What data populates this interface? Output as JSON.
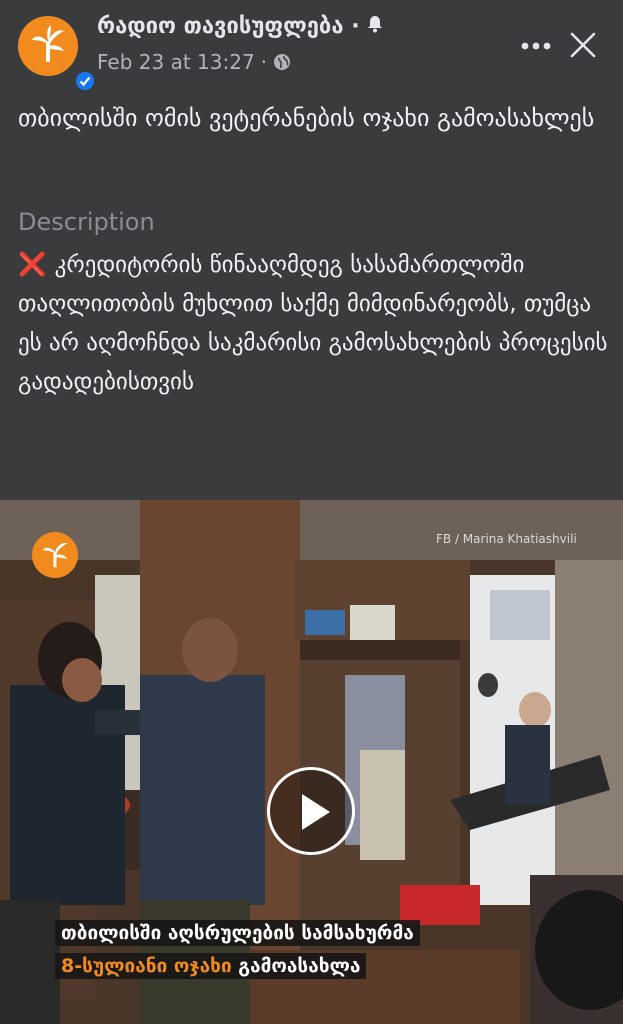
{
  "header": {
    "page_name": "რადიო თავისუფლება",
    "date": "Feb 23 at 13:27",
    "separator": "·",
    "name_separator": "·"
  },
  "icons": {
    "avatar": "rfe-logo-icon",
    "verified": "verified-badge-icon",
    "bell": "bell-icon",
    "globe": "globe-icon",
    "more": "more-dots-icon",
    "close": "close-icon",
    "play": "play-icon",
    "xmark": "red-x-icon"
  },
  "colors": {
    "brand": "#f28b1e",
    "background": "#3a3b3c",
    "verified": "#1877f2",
    "xmark": "#e53935"
  },
  "post": {
    "title": "თბილისში ომის ვეტერანების ოჯახი გამოასახლეს",
    "description_label": "Description",
    "description_mark": "❌",
    "description": "კრედიტორის წინააღმდეგ სასამართლოში თაღლითობის მუხლით საქმე მიმდინარეობს, თუმცა ეს არ აღმოჩნდა საკმარისი გამოსახლების პროცესის გადადებისთვის"
  },
  "video": {
    "credit": "FB / Marina Khatiashvili",
    "caption_line1": "თბილისში აღსრულების სამსახურმა",
    "caption_line2_highlight": "8-სულიანი ოჯახი",
    "caption_line2_rest": " გამოასახლა"
  }
}
